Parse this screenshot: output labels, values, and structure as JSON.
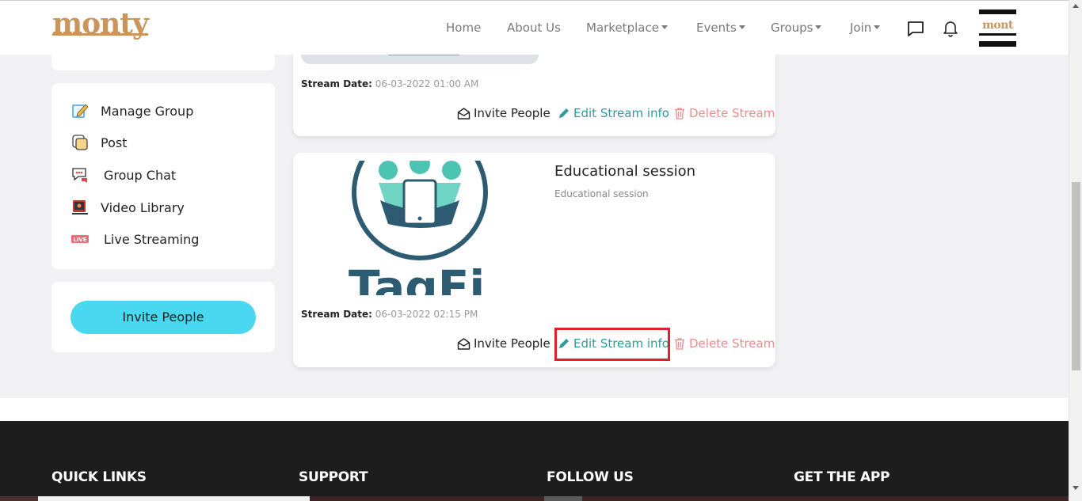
{
  "brand": {
    "logo": "monty",
    "avatar_text": "mont"
  },
  "nav": {
    "home": "Home",
    "about": "About Us",
    "marketplace": "Marketplace",
    "events": "Events",
    "groups": "Groups",
    "join": "Join"
  },
  "sidebar": {
    "items": [
      {
        "label": "Manage Group",
        "icon": "edit-note-icon"
      },
      {
        "label": "Post",
        "icon": "post-icon"
      },
      {
        "label": "Group Chat",
        "icon": "chat-icon"
      },
      {
        "label": "Video Library",
        "icon": "video-library-icon"
      },
      {
        "label": "Live Streaming",
        "icon": "live-icon"
      }
    ],
    "live_badge": "LIVE",
    "invite_button": "Invite People"
  },
  "streams": [
    {
      "date_label": "Stream Date:",
      "date_value": "06-03-2022 01:00 AM",
      "invite": "Invite People",
      "edit": "Edit Stream info",
      "delete": "Delete Stream"
    },
    {
      "title": "Educational session",
      "description": "Educational session",
      "logo_text": "TagFi",
      "date_label": "Stream Date:",
      "date_value": "06-03-2022 02:15 PM",
      "invite": "Invite People",
      "edit": "Edit Stream info",
      "delete": "Delete Stream"
    }
  ],
  "footer": {
    "quick_links": "QUICK LINKS",
    "support": "SUPPORT",
    "follow_us": "FOLLOW US",
    "get_app": "GET THE APP"
  },
  "colors": {
    "brand": "#c9955a",
    "accent": "#49d8ef",
    "edit": "#2c9c9c",
    "delete": "#ec8c8c",
    "highlight": "#e0202a",
    "footer_bg": "#1d1d1d"
  }
}
